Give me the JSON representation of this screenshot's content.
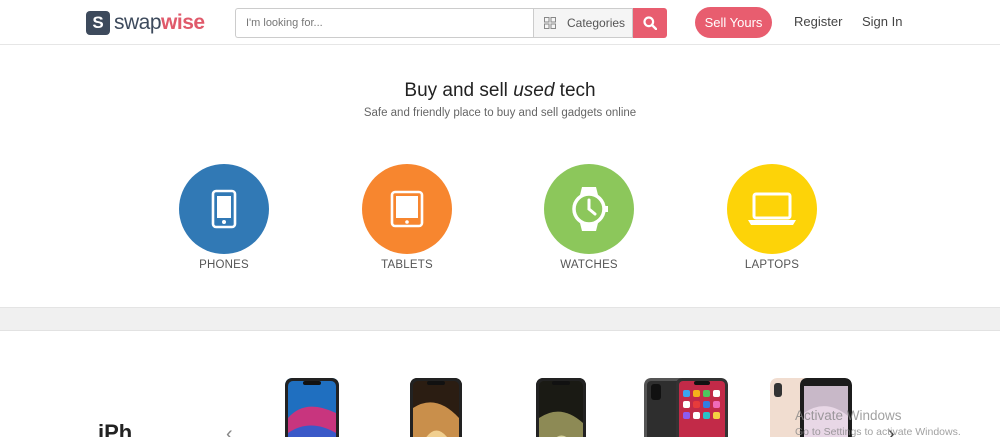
{
  "header": {
    "logo_mark": "S",
    "logo_text_light": "swap",
    "logo_text_bold": "wise",
    "search_placeholder": "I'm looking for...",
    "categories_label": "Categories",
    "sell_label": "Sell Yours",
    "register_label": "Register",
    "signin_label": "Sign In"
  },
  "hero": {
    "title_pre": "Buy and sell ",
    "title_em": "used",
    "title_post": " tech",
    "subtitle": "Safe and friendly place to buy and sell gadgets online"
  },
  "categories": [
    {
      "label": "PHONES",
      "color": "#3179b5",
      "icon": "phone-icon"
    },
    {
      "label": "TABLETS",
      "color": "#f7862f",
      "icon": "tablet-icon"
    },
    {
      "label": "WATCHES",
      "color": "#8cc75b",
      "icon": "watch-icon"
    },
    {
      "label": "LAPTOPS",
      "color": "#fdd308",
      "icon": "laptop-icon"
    }
  ],
  "products": {
    "section_title": "iPh",
    "prev_arrow": "‹",
    "next_arrow": "›"
  },
  "watermark": {
    "line1": "Activate Windows",
    "line2": "Go to Settings to activate Windows."
  },
  "colors": {
    "accent": "#e85d6f",
    "logo": "#3d4a5c"
  }
}
